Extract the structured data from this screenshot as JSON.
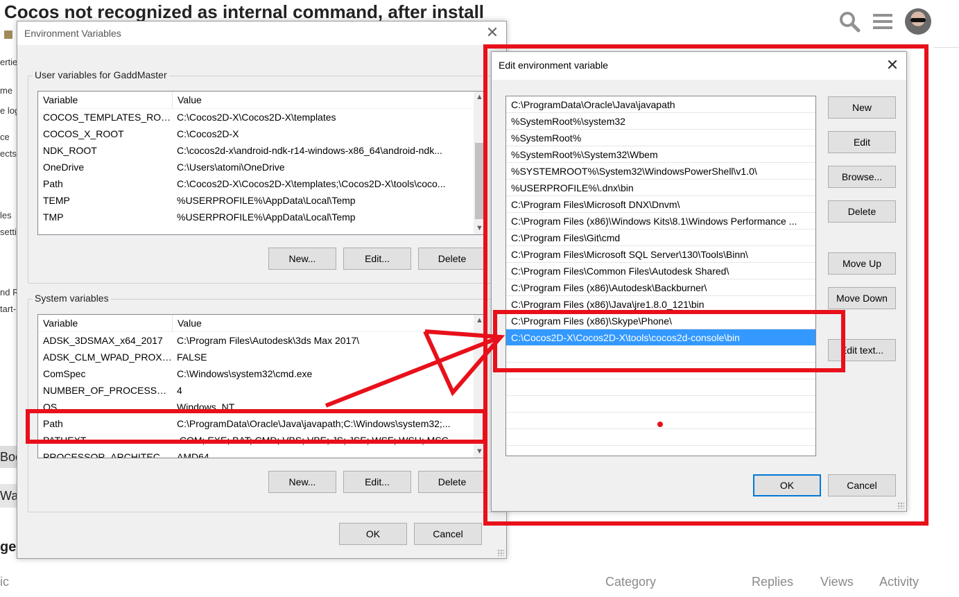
{
  "background_page": {
    "title": "Cocos not recognized as internal command, after install",
    "left_fragments": [
      "ertie",
      "me",
      "e log",
      "ce",
      "ects,",
      "les",
      "setti",
      "nd R",
      "tart-u",
      "Boo",
      "Wat",
      "ges"
    ],
    "topic_header": {
      "topic": "ic",
      "category": "Category",
      "replies": "Replies",
      "views": "Views",
      "activity": "Activity"
    },
    "icons": [
      "search-icon",
      "hamburger-menu-icon",
      "avatar"
    ]
  },
  "env_dialog": {
    "title": "Environment Variables",
    "user_section": {
      "label": "User variables for GaddMaster",
      "columns": [
        "Variable",
        "Value"
      ],
      "rows": [
        {
          "variable": "COCOS_TEMPLATES_ROOT",
          "value": "C:\\Cocos2D-X\\Cocos2D-X\\templates"
        },
        {
          "variable": "COCOS_X_ROOT",
          "value": "C:\\Cocos2D-X"
        },
        {
          "variable": "NDK_ROOT",
          "value": "C:\\cocos2d-x\\android-ndk-r14-windows-x86_64\\android-ndk..."
        },
        {
          "variable": "OneDrive",
          "value": "C:\\Users\\atomi\\OneDrive"
        },
        {
          "variable": "Path",
          "value": "C:\\Cocos2D-X\\Cocos2D-X\\templates;\\Cocos2D-X\\tools\\coco..."
        },
        {
          "variable": "TEMP",
          "value": "%USERPROFILE%\\AppData\\Local\\Temp"
        },
        {
          "variable": "TMP",
          "value": "%USERPROFILE%\\AppData\\Local\\Temp"
        }
      ],
      "buttons": {
        "new": "New...",
        "edit": "Edit...",
        "delete": "Delete"
      }
    },
    "system_section": {
      "label": "System variables",
      "columns": [
        "Variable",
        "Value"
      ],
      "rows": [
        {
          "variable": "ADSK_3DSMAX_x64_2017",
          "value": "C:\\Program Files\\Autodesk\\3ds Max 2017\\"
        },
        {
          "variable": "ADSK_CLM_WPAD_PROXY...",
          "value": "FALSE"
        },
        {
          "variable": "ComSpec",
          "value": "C:\\Windows\\system32\\cmd.exe"
        },
        {
          "variable": "NUMBER_OF_PROCESSORS",
          "value": "4"
        },
        {
          "variable": "OS",
          "value": "Windows_NT"
        },
        {
          "variable": "Path",
          "value": "C:\\ProgramData\\Oracle\\Java\\javapath;C:\\Windows\\system32;..."
        },
        {
          "variable": "PATHEXT",
          "value": ".COM;.EXE;.BAT;.CMD;.VBS;.VBE;.JS;.JSE;.WSF;.WSH;.MSC"
        },
        {
          "variable": "PROCESSOR_ARCHITECTU...",
          "value": "AMD64"
        }
      ],
      "buttons": {
        "new": "New...",
        "edit": "Edit...",
        "delete": "Delete"
      }
    },
    "ok": "OK",
    "cancel": "Cancel"
  },
  "edit_dialog": {
    "title": "Edit environment variable",
    "paths": [
      "C:\\ProgramData\\Oracle\\Java\\javapath",
      "%SystemRoot%\\system32",
      "%SystemRoot%",
      "%SystemRoot%\\System32\\Wbem",
      "%SYSTEMROOT%\\System32\\WindowsPowerShell\\v1.0\\",
      "%USERPROFILE%\\.dnx\\bin",
      "C:\\Program Files\\Microsoft DNX\\Dnvm\\",
      "C:\\Program Files (x86)\\Windows Kits\\8.1\\Windows Performance ...",
      "C:\\Program Files\\Git\\cmd",
      "C:\\Program Files\\Microsoft SQL Server\\130\\Tools\\Binn\\",
      "C:\\Program Files\\Common Files\\Autodesk Shared\\",
      "C:\\Program Files (x86)\\Autodesk\\Backburner\\",
      "C:\\Program Files (x86)\\Java\\jre1.8.0_121\\bin",
      "C:\\Program Files (x86)\\Skype\\Phone\\",
      "C:\\Cocos2D-X\\Cocos2D-X\\tools\\cocos2d-console\\bin"
    ],
    "selected_index": 14,
    "buttons": {
      "new": "New",
      "edit": "Edit",
      "browse": "Browse...",
      "delete": "Delete",
      "move_up": "Move Up",
      "move_down": "Move Down",
      "edit_text": "Edit text..."
    },
    "ok": "OK",
    "cancel": "Cancel"
  },
  "colors": {
    "annotation_red": "#e8101a",
    "selection_blue": "#3399ff",
    "default_button_border": "#0078d7"
  }
}
